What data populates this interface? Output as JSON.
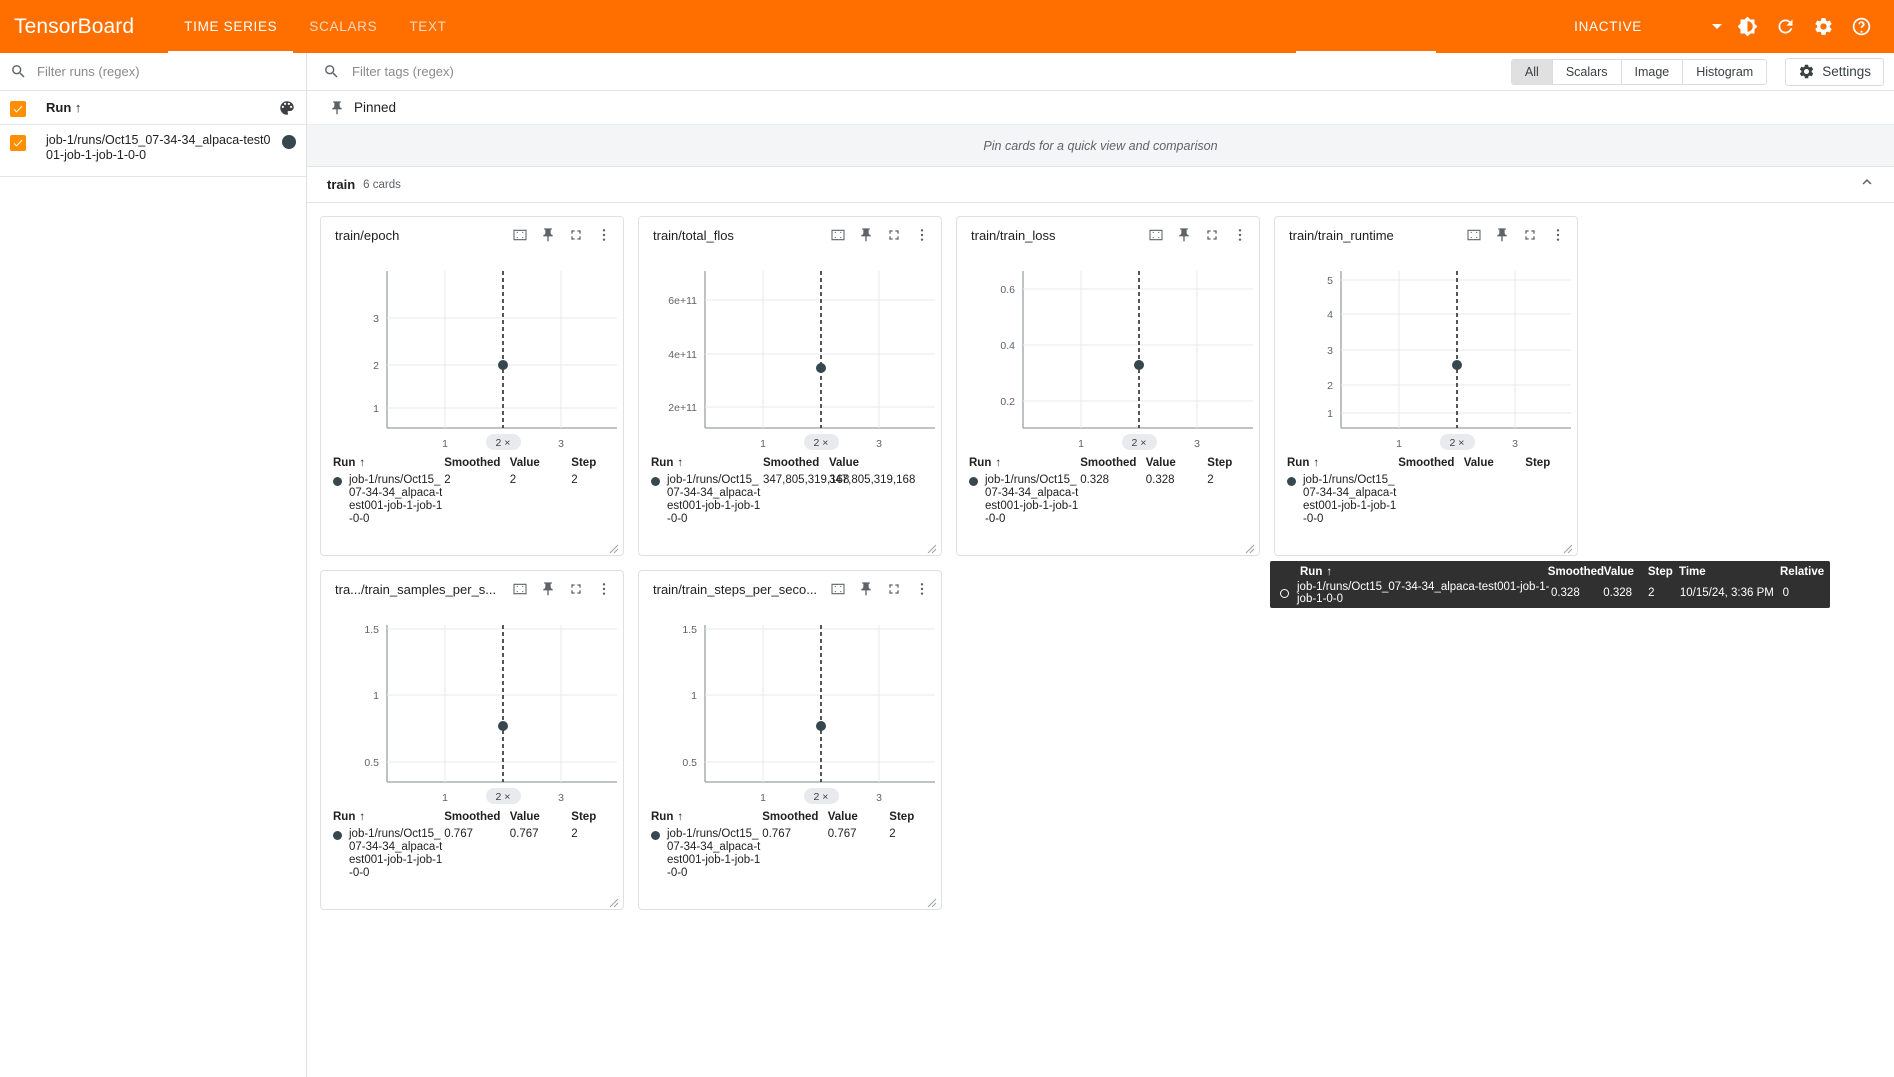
{
  "header": {
    "brand": "TensorBoard",
    "tabs": [
      {
        "label": "TIME SERIES",
        "active": true
      },
      {
        "label": "SCALARS",
        "active": false
      },
      {
        "label": "TEXT",
        "active": false
      }
    ],
    "status": "INACTIVE",
    "icons": [
      "caret-down-icon",
      "brightness-icon",
      "refresh-icon",
      "settings-gear-icon",
      "help-icon"
    ]
  },
  "sidebar": {
    "filter_placeholder": "Filter runs (regex)",
    "run_column_header": "Run",
    "sort_arrow": "↑",
    "runs": [
      {
        "name": "job-1/runs/Oct15_07-34-34_alpaca-test001-job-1-job-1-0-0",
        "checked": true,
        "color": "#37474f"
      }
    ]
  },
  "toolbar": {
    "tag_filter_placeholder": "Filter tags (regex)",
    "plugin_filters": [
      {
        "label": "All",
        "selected": true
      },
      {
        "label": "Scalars",
        "selected": false
      },
      {
        "label": "Image",
        "selected": false
      },
      {
        "label": "Histogram",
        "selected": false
      }
    ],
    "settings_label": "Settings"
  },
  "pinned": {
    "title": "Pinned",
    "empty_message": "Pin cards for a quick view and comparison"
  },
  "group": {
    "name": "train",
    "count_label": "6 cards"
  },
  "table_headers": {
    "run": "Run",
    "smoothed": "Smoothed",
    "value": "Value",
    "step": "Step",
    "time": "Time",
    "relative": "Relative"
  },
  "run_short_lines": [
    "job-",
    "1/runs/Oct15_07-",
    "34-34_alpaca-",
    "test001-job-1-job-",
    "1-0-0"
  ],
  "cards": [
    {
      "title": "train/epoch",
      "smoothed": "2",
      "value": "2",
      "step": "2",
      "y_ticks": [
        "3",
        "2",
        "1"
      ],
      "x_ticks": [
        "1",
        "2 ×",
        "3"
      ]
    },
    {
      "title": "train/total_flos",
      "smoothed": "347,805,319,168",
      "value": "347,805,319,168",
      "step": "2",
      "y_ticks": [
        "6e+11",
        "4e+11",
        "2e+11"
      ],
      "x_ticks": [
        "1",
        "2 ×",
        "3"
      ]
    },
    {
      "title": "train/train_loss",
      "smoothed": "0.328",
      "value": "0.328",
      "step": "2",
      "y_ticks": [
        "0.6",
        "0.4",
        "0.2"
      ],
      "x_ticks": [
        "1",
        "2 ×",
        "3"
      ]
    },
    {
      "title": "train/train_runtime",
      "smoothed": "",
      "value": "",
      "step": "",
      "y_ticks": [
        "5",
        "4",
        "3",
        "2",
        "1"
      ],
      "x_ticks": [
        "1",
        "2 ×",
        "3"
      ]
    },
    {
      "title": "tra.../train_samples_per_s...",
      "smoothed": "0.767",
      "value": "0.767",
      "step": "2",
      "y_ticks": [
        "1.5",
        "1",
        "0.5"
      ],
      "x_ticks": [
        "1",
        "2 ×",
        "3"
      ]
    },
    {
      "title": "train/train_steps_per_seco...",
      "smoothed": "0.767",
      "value": "0.767",
      "step": "2",
      "y_ticks": [
        "1.5",
        "1",
        "0.5"
      ],
      "x_ticks": [
        "1",
        "2 ×",
        "3"
      ]
    }
  ],
  "tooltip": {
    "headers": {
      "run": "Run",
      "smoothed": "Smoothed",
      "value": "Value",
      "step": "Step",
      "time": "Time",
      "relative": "Relative"
    },
    "sort_arrow": "↑",
    "row": {
      "run": "job-1/runs/Oct15_07-34-34_alpaca-test001-job-1-job-1-0-0",
      "smoothed": "0.328",
      "value": "0.328",
      "step": "2",
      "time": "10/15/24, 3:36 PM",
      "relative": "0"
    }
  },
  "chart_data": [
    {
      "type": "scatter",
      "title": "train/epoch",
      "x": [
        2
      ],
      "y": [
        2
      ],
      "xlabel": "Step",
      "ylabel": "",
      "xlim": [
        0.5,
        3.5
      ],
      "ylim": [
        0.6,
        3.6
      ],
      "xticks": [
        1,
        2,
        3
      ],
      "yticks": [
        1,
        2,
        3
      ],
      "grid": true,
      "legend": false,
      "marker_step": 2,
      "marker_value": 2
    },
    {
      "type": "scatter",
      "title": "train/total_flos",
      "x": [
        2
      ],
      "y": [
        347805319168
      ],
      "xlabel": "Step",
      "ylabel": "",
      "xlim": [
        0.5,
        3.5
      ],
      "ylim": [
        100000000000,
        700000000000
      ],
      "xticks": [
        1,
        2,
        3
      ],
      "yticks": [
        200000000000,
        400000000000,
        600000000000
      ],
      "ytick_labels": [
        "2e+11",
        "4e+11",
        "6e+11"
      ],
      "grid": true,
      "legend": false,
      "marker_step": 2,
      "marker_value": 347805319168
    },
    {
      "type": "scatter",
      "title": "train/train_loss",
      "x": [
        2
      ],
      "y": [
        0.328
      ],
      "xlabel": "Step",
      "ylabel": "",
      "xlim": [
        0.5,
        3.5
      ],
      "ylim": [
        0.1,
        0.68
      ],
      "xticks": [
        1,
        2,
        3
      ],
      "yticks": [
        0.2,
        0.4,
        0.6
      ],
      "grid": true,
      "legend": false,
      "marker_step": 2,
      "marker_value": 0.328
    },
    {
      "type": "scatter",
      "title": "train/train_runtime",
      "x": [
        2
      ],
      "y": [
        2.6
      ],
      "xlabel": "Step",
      "ylabel": "",
      "xlim": [
        0.5,
        3.5
      ],
      "ylim": [
        0.5,
        5.4
      ],
      "xticks": [
        1,
        2,
        3
      ],
      "yticks": [
        1,
        2,
        3,
        4,
        5
      ],
      "grid": true,
      "legend": false,
      "marker_step": 2,
      "marker_value": 2.6
    },
    {
      "type": "scatter",
      "title": "tra.../train_samples_per_s...",
      "x": [
        2
      ],
      "y": [
        0.767
      ],
      "xlabel": "Step",
      "ylabel": "",
      "xlim": [
        0.5,
        3.5
      ],
      "ylim": [
        0.3,
        1.6
      ],
      "xticks": [
        1,
        2,
        3
      ],
      "yticks": [
        0.5,
        1,
        1.5
      ],
      "grid": true,
      "legend": false,
      "marker_step": 2,
      "marker_value": 0.767
    },
    {
      "type": "scatter",
      "title": "train/train_steps_per_seco...",
      "x": [
        2
      ],
      "y": [
        0.767
      ],
      "xlabel": "Step",
      "ylabel": "",
      "xlim": [
        0.5,
        3.5
      ],
      "ylim": [
        0.3,
        1.6
      ],
      "xticks": [
        1,
        2,
        3
      ],
      "yticks": [
        0.5,
        1,
        1.5
      ],
      "grid": true,
      "legend": false,
      "marker_step": 2,
      "marker_value": 0.767
    }
  ],
  "colors": {
    "header_bg": "#ff6f00",
    "accent": "#ff8f00",
    "series": "#37474f",
    "tooltip_bg": "#303030"
  }
}
